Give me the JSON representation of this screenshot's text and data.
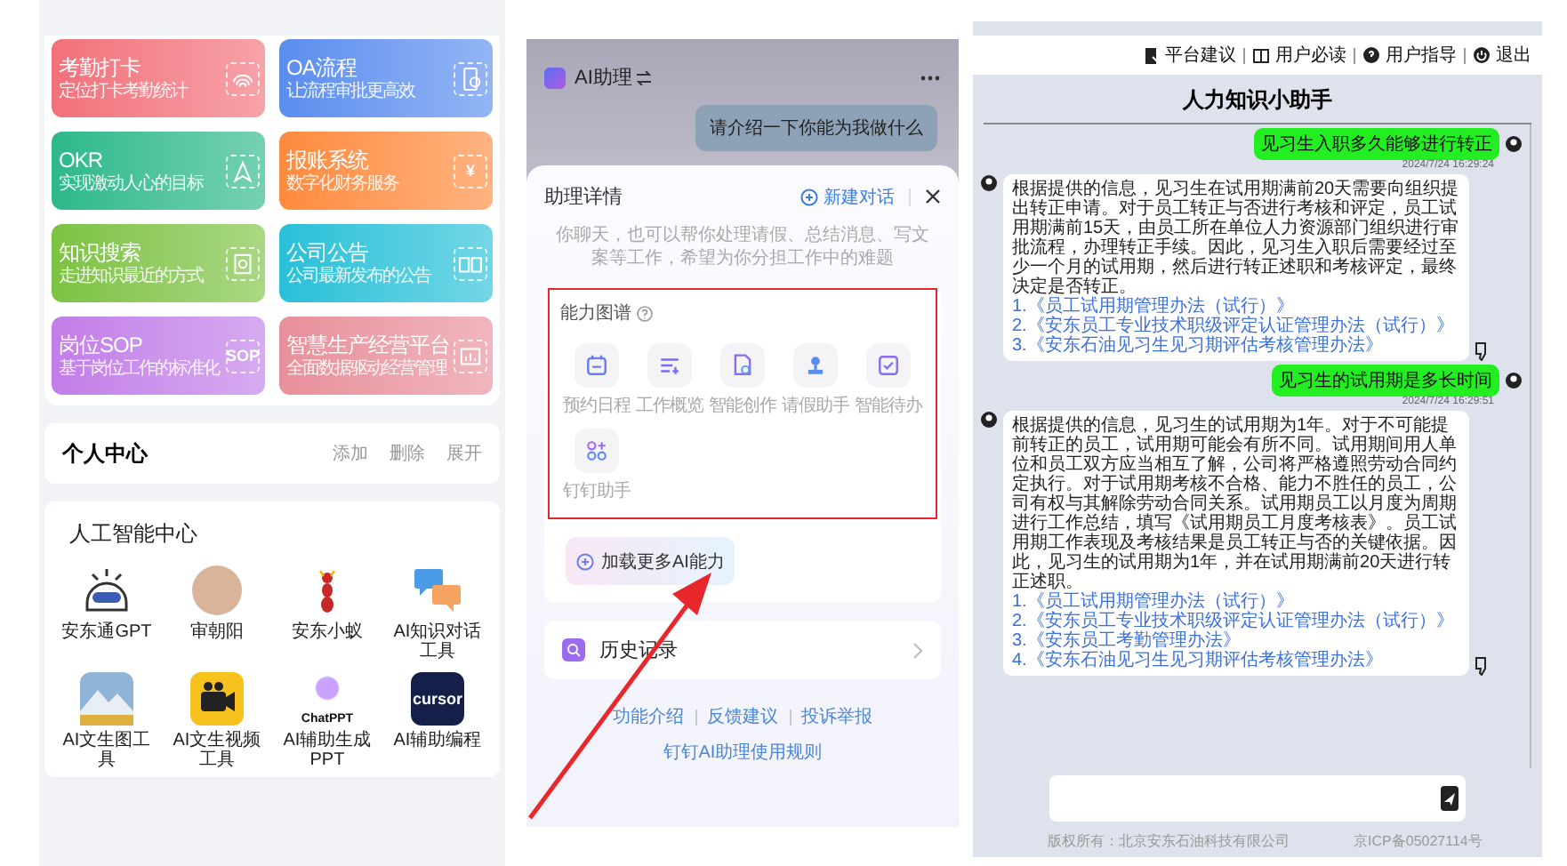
{
  "workbench": {
    "tiles": [
      {
        "title": "考勤打卡",
        "subtitle": "定位打卡考勤统计",
        "color": "#f2707a"
      },
      {
        "title": "OA流程",
        "subtitle": "让流程审批更高效",
        "color": "#5b8def"
      },
      {
        "title": "OKR",
        "subtitle": "实现激动人心的目标",
        "color": "#2cb88a"
      },
      {
        "title": "报账系统",
        "subtitle": "数字化财务服务",
        "color": "#ff8a3d",
        "icon_text": "¥"
      },
      {
        "title": "知识搜索",
        "subtitle": "走进知识最近的方式",
        "color": "#7cc242"
      },
      {
        "title": "公司公告",
        "subtitle": "公司最新发布的公告",
        "color": "#28c0d8"
      },
      {
        "title": "岗位SOP",
        "subtitle": "基于岗位工作的标准化",
        "color": "#c27de8",
        "icon_text": "SOP"
      },
      {
        "title": "智慧生产经营平台",
        "subtitle": "全面数据驱动经营管理",
        "color": "#e88f9a"
      }
    ],
    "personal": {
      "title": "个人中心",
      "actions": [
        "添加",
        "删除",
        "展开"
      ]
    },
    "ai_center": {
      "title": "人工智能中心",
      "apps": [
        {
          "label": "安东通GPT"
        },
        {
          "label": "审朝阳"
        },
        {
          "label": "安东小蚁"
        },
        {
          "label": "AI知识对话工具"
        },
        {
          "label": "AI文生图工具"
        },
        {
          "label": "AI文生视频工具"
        },
        {
          "label": "AI辅助生成PPT",
          "logo_text": "ChatPPT"
        },
        {
          "label": "AI辅助编程",
          "logo_text": "cursor"
        }
      ]
    }
  },
  "assistant": {
    "title": "AI助理",
    "user_message": "请介绍一下你能为我做什么",
    "sheet": {
      "title": "助理详情",
      "new_chat": "新建对话",
      "description": "你聊天，也可以帮你处理请假、总结消息、写文案等工作，希望为你分担工作中的难题",
      "abilities_title": "能力图谱",
      "abilities": [
        "预约日程",
        "工作概览",
        "智能创作",
        "请假助手",
        "智能待办",
        "钉钉助手"
      ],
      "load_more": "加载更多AI能力",
      "history": "历史记录",
      "links": [
        "功能介绍",
        "反馈建议",
        "投诉举报"
      ],
      "rules_link": "钉钉AI助理使用规则"
    }
  },
  "hr_assistant": {
    "nav": [
      "平台建议",
      "用户必读",
      "用户指导",
      "退出"
    ],
    "title": "人力知识小助手",
    "messages": [
      {
        "kind": "user",
        "text": "见习生入职多久能够进行转正",
        "time": "2024/7/24 16:29:24"
      },
      {
        "kind": "bot",
        "text": "根据提供的信息，见习生在试用期满前20天需要向组织提出转正申请。对于员工转正与否进行考核和评定，员工试用期满前15天，由员工所在单位人力资源部门组织进行审批流程，办理转正手续。因此，见习生入职后需要经过至少一个月的试用期，然后进行转正述职和考核评定，最终决定是否转正。",
        "links": [
          "1.《员工试用期管理办法（试行）》",
          "2.《安东员工专业技术职级评定认证管理办法（试行）》",
          "3.《安东石油见习生见习期评估考核管理办法》"
        ]
      },
      {
        "kind": "user",
        "text": "见习生的试用期是多长时间",
        "time": "2024/7/24 16:29:51"
      },
      {
        "kind": "bot",
        "text": "根据提供的信息，见习生的试用期为1年。对于不可能提前转正的员工，试用期可能会有所不同。试用期间用人单位和员工双方应当相互了解，公司将严格遵照劳动合同约定执行。对于试用期考核不合格、能力不胜任的员工，公司有权与其解除劳动合同关系。试用期员工以月度为周期进行工作总结，填写《试用期员工月度考核表》。员工试用期工作表现及考核结果是员工转正与否的关键依据。因此，见习生的试用期为1年，并在试用期满前20天进行转正述职。",
        "links": [
          "1.《员工试用期管理办法（试行）》",
          "2.《安东员工专业技术职级评定认证管理办法（试行）》",
          "3.《安东员工考勤管理办法》",
          "4.《安东石油见习生见习期评估考核管理办法》"
        ]
      }
    ],
    "footer": [
      "版权所有：北京安东石油科技有限公司",
      "京ICP备05027114号"
    ]
  }
}
